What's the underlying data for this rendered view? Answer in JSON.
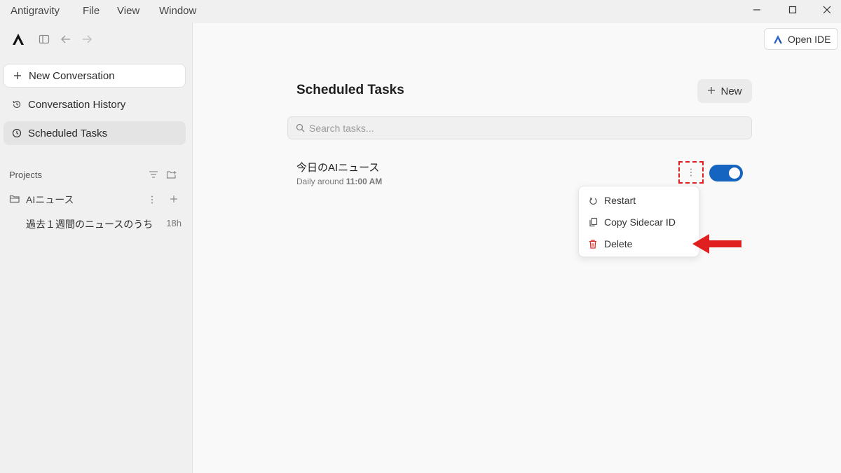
{
  "menubar": {
    "items": [
      "Antigravity",
      "File",
      "View",
      "Window"
    ]
  },
  "window_controls": {
    "minimize": "minimize-icon",
    "maximize": "maximize-icon",
    "close": "close-icon"
  },
  "sidebar": {
    "new_conversation": "New Conversation",
    "conversation_history": "Conversation History",
    "scheduled_tasks": "Scheduled Tasks",
    "projects_label": "Projects",
    "project_name": "AIニュース",
    "conversation_title": "過去１週間のニュースのうち",
    "conversation_age": "18h"
  },
  "header": {
    "open_ide_label": "Open IDE"
  },
  "main": {
    "title": "Scheduled Tasks",
    "new_label": "New",
    "search_placeholder": "Search tasks...",
    "task": {
      "name": "今日のAIニュース",
      "schedule_prefix": "Daily around ",
      "schedule_time": "11:00 AM",
      "enabled": true
    }
  },
  "context_menu": {
    "items": [
      "Restart",
      "Copy Sidecar ID",
      "Delete"
    ]
  },
  "colors": {
    "accent": "#1565c0",
    "annotation": "#e02020",
    "danger_icon": "#d93025"
  }
}
